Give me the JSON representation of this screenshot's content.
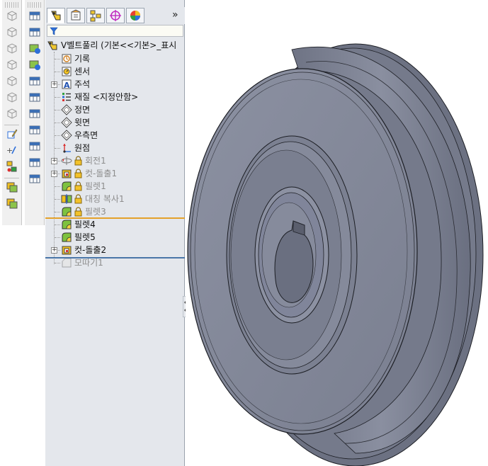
{
  "toolbar_left": {
    "col_a": [
      "box-icon",
      "box-icon",
      "box-icon",
      "box-icon",
      "box-icon",
      "box-icon",
      "box-icon",
      "sketch-icon",
      "reference-icon",
      "mate-icon",
      "assembly-icon",
      "assembly-icon"
    ],
    "col_b": [
      "table-icon",
      "table-icon",
      "feature-icon",
      "feature-icon",
      "table-icon",
      "table-icon",
      "table-icon",
      "table-icon",
      "table-icon",
      "table-icon",
      "table-icon"
    ]
  },
  "tabs": {
    "items": [
      "feature-manager-tab",
      "property-manager-tab",
      "configuration-manager-tab",
      "dimxpert-tab",
      "display-manager-tab"
    ],
    "more_label": "»"
  },
  "tree": {
    "root_label": "V벨트풀리  (기본<<기본>_표시",
    "items": [
      {
        "label": "기록",
        "icon": "history-icon",
        "dim": false,
        "expand": false,
        "lock": false
      },
      {
        "label": "센서",
        "icon": "sensor-icon",
        "dim": false,
        "expand": false,
        "lock": false
      },
      {
        "label": "주석",
        "icon": "annotation-icon",
        "dim": false,
        "expand": true,
        "lock": false
      },
      {
        "label": "재질 <지정안함>",
        "icon": "material-icon",
        "dim": false,
        "expand": false,
        "lock": false
      },
      {
        "label": "정면",
        "icon": "plane-icon",
        "dim": false,
        "expand": false,
        "lock": false
      },
      {
        "label": "윗면",
        "icon": "plane-icon",
        "dim": false,
        "expand": false,
        "lock": false
      },
      {
        "label": "우측면",
        "icon": "plane-icon",
        "dim": false,
        "expand": false,
        "lock": false
      },
      {
        "label": "원점",
        "icon": "origin-icon",
        "dim": false,
        "expand": false,
        "lock": false
      },
      {
        "label": "회전1",
        "icon": "revolve-icon",
        "dim": true,
        "expand": true,
        "lock": true
      },
      {
        "label": "컷-돌출1",
        "icon": "cut-extrude-icon",
        "dim": true,
        "expand": true,
        "lock": true
      },
      {
        "label": "필렛1",
        "icon": "fillet-icon",
        "dim": true,
        "expand": false,
        "lock": true
      },
      {
        "label": "대칭 복사1",
        "icon": "mirror-icon",
        "dim": true,
        "expand": false,
        "lock": true
      },
      {
        "label": "필렛3",
        "icon": "fillet-icon",
        "dim": true,
        "expand": false,
        "lock": true
      },
      {
        "label": "필렛4",
        "icon": "fillet-icon",
        "dim": false,
        "expand": false,
        "lock": false
      },
      {
        "label": "필렛5",
        "icon": "fillet-icon",
        "dim": false,
        "expand": false,
        "lock": false
      },
      {
        "label": "컷-돌출2",
        "icon": "cut-extrude-icon",
        "dim": false,
        "expand": true,
        "lock": false
      },
      {
        "label": "모따기1",
        "icon": "chamfer-icon",
        "dim": true,
        "expand": false,
        "lock": false
      }
    ]
  },
  "viewport": {
    "model": "v-belt-pulley",
    "body_color": "#7f8494",
    "edge_color": "#1c1e24"
  },
  "colors": {
    "panel_bg": "#e4e7ec",
    "rollback_orange": "#e4a12a",
    "rollback_blue": "#4a76a8",
    "fillet_green": "#7ec23f",
    "feature_yellow": "#f3d341"
  }
}
